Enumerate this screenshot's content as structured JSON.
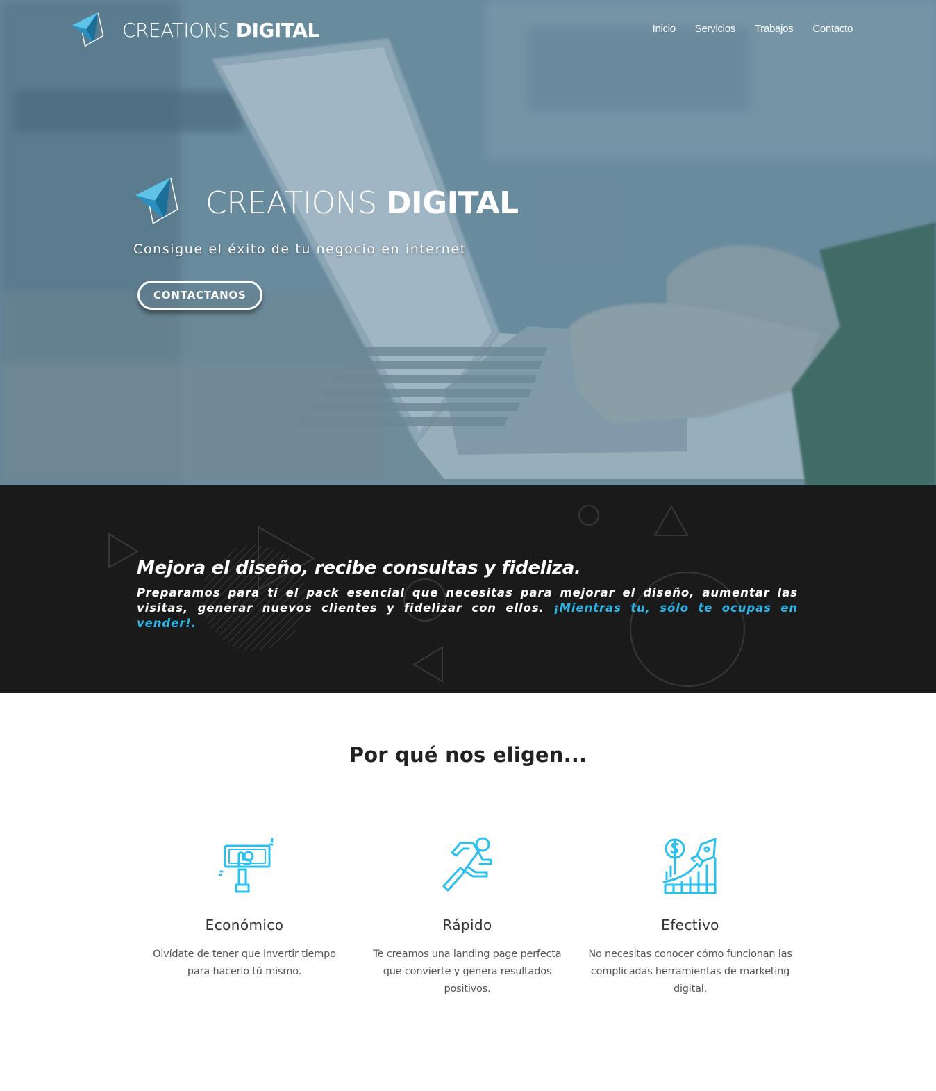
{
  "brand": {
    "light": "CREATIONS ",
    "bold": "DIGITAL"
  },
  "nav": {
    "items": [
      "Inicio",
      "Servicios",
      "Trabajos",
      "Contacto"
    ]
  },
  "hero": {
    "tagline": "Consigue el éxito de tu negocio en internet",
    "cta_label": "CONTACTANOS"
  },
  "band": {
    "title": "Mejora el diseño, recibe consultas y fideliza.",
    "body": "Preparamos para ti el pack esencial que necesitas para mejorar el diseño, aumentar las visitas, generar nuevos clientes y fidelizar con ellos.",
    "highlight": "¡Mientras tu, sólo te ocupas en vender!."
  },
  "why": {
    "title": "Por qué nos eligen..."
  },
  "features": [
    {
      "icon": "money-hand-icon",
      "title": "Económico",
      "text": "Olvídate de tener que invertir tiempo para hacerlo tú mismo."
    },
    {
      "icon": "running-person-icon",
      "title": "Rápido",
      "text": "Te creamos una landing page perfecta que convierte y genera resultados positivos."
    },
    {
      "icon": "rocket-growth-icon",
      "title": "Efectivo",
      "text": "No necesitas conocer cómo funcionan las complicadas herramientas de marketing digital."
    }
  ],
  "colors": {
    "accent": "#29b6e8",
    "band_bg": "#1a1a1a",
    "hero_tint": "#6f8ea0"
  }
}
